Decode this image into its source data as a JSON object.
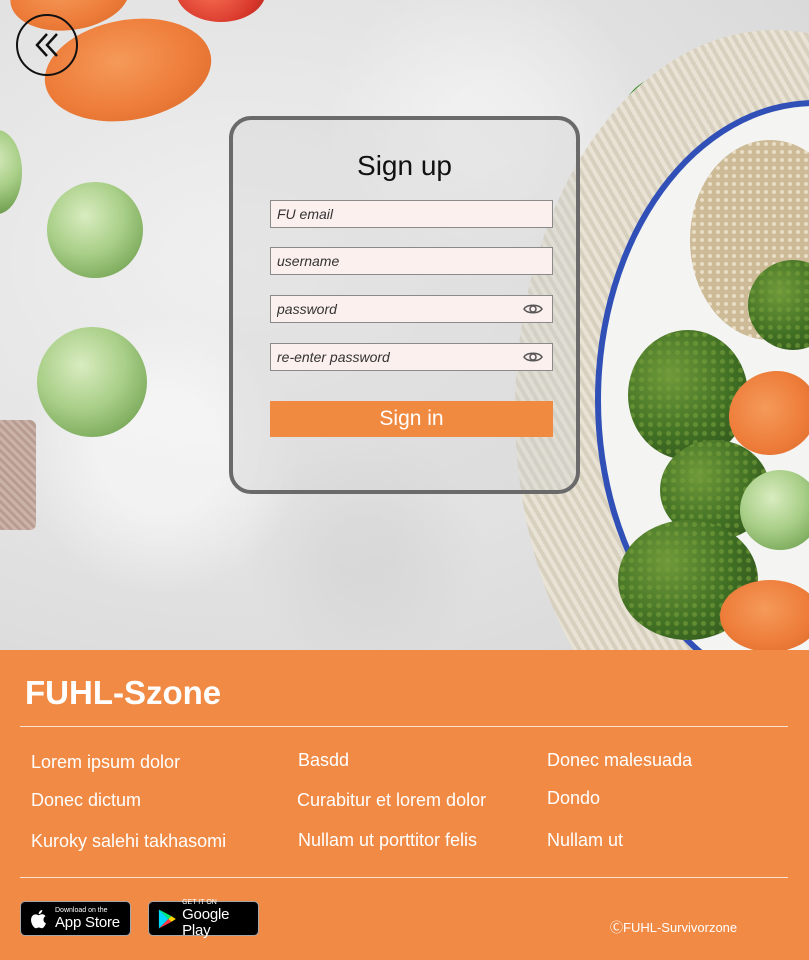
{
  "back_button": {
    "icon": "double-chevron-left-icon"
  },
  "signup": {
    "title": "Sign up",
    "fields": {
      "email_placeholder": "FU email",
      "username_placeholder": "username",
      "password_placeholder": "password",
      "reenter_placeholder": "re-enter password"
    },
    "submit_label": "Sign in",
    "accent": "#f08a40"
  },
  "footer": {
    "brand": "FUHL-Szone",
    "background": "#f08a44",
    "links": [
      [
        "Lorem ipsum dolor",
        "Basdd",
        "Donec malesuada"
      ],
      [
        "Donec dictum",
        "Curabitur et lorem dolor",
        "Dondo"
      ],
      [
        "Kuroky salehi takhasomi",
        "Nullam ut porttitor felis",
        "Nullam ut"
      ]
    ],
    "app_store": {
      "small": "Download on the",
      "big": "App Store"
    },
    "google_play": {
      "small": "GET IT ON",
      "big": "Google Play"
    },
    "copyright": "ⒸFUHL-Survivorzone"
  }
}
